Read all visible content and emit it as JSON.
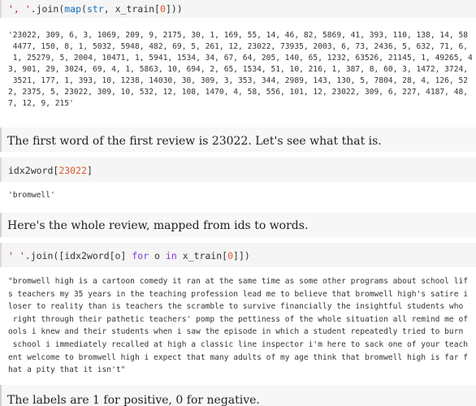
{
  "cells": {
    "code1": {
      "p1": "', '",
      "p2": ".join(",
      "p3": "map",
      "p4": "(",
      "p5": "str",
      "p6": ", x_train[",
      "p7": "0",
      "p8": "]))"
    },
    "out1_lines": [
      "'23022, 309, 6, 3, 1069, 209, 9, 2175, 30, 1, 169, 55, 14, 46, 82, 5869, 41, 393, 110, 138, 14, 58",
      " 4477, 150, 8, 1, 5032, 5948, 482, 69, 5, 261, 12, 23022, 73935, 2003, 6, 73, 2436, 5, 632, 71, 6,",
      " 1, 25279, 5, 2004, 10471, 1, 5941, 1534, 34, 67, 64, 205, 140, 65, 1232, 63526, 21145, 1, 49265, 4",
      "3, 901, 29, 3024, 69, 4, 1, 5863, 10, 694, 2, 65, 1534, 51, 10, 216, 1, 387, 8, 60, 3, 1472, 3724,",
      " 3521, 177, 1, 393, 10, 1238, 14030, 30, 309, 3, 353, 344, 2989, 143, 130, 5, 7804, 28, 4, 126, 52",
      "2, 2375, 5, 23022, 309, 10, 532, 12, 108, 1470, 4, 58, 556, 101, 12, 23022, 309, 6, 227, 4187, 48,",
      "7, 12, 9, 215'"
    ],
    "md1": "The first word of the first review is 23022. Let's see what that is.",
    "code2": {
      "p1": "idx2word[",
      "p2": "23022",
      "p3": "]"
    },
    "out2": "'bromwell'",
    "md2": "Here's the whole review, mapped from ids to words.",
    "code3": {
      "p1": "' '",
      "p2": ".join([idx2word[o] ",
      "p3": "for",
      "p4": " o ",
      "p5": "in",
      "p6": " x_train[",
      "p7": "0",
      "p8": "]])"
    },
    "out3_lines": [
      "\"bromwell high is a cartoon comedy it ran at the same time as some other programs about school lif",
      "s teachers my 35 years in the teaching profession lead me to believe that bromwell high's satire i",
      "loser to reality than is teachers the scramble to survive financially the insightful students who",
      " right through their pathetic teachers' pomp the pettiness of the whole situation all remind me of",
      "ools i knew and their students when i saw the episode in which a student repeatedly tried to burn",
      " school i immediately recalled at high a classic line inspector i'm here to sack one of your teach",
      "ent welcome to bromwell high i expect that many adults of my age think that bromwell high is far f",
      "hat a pity that it isn't\""
    ],
    "md3": "The labels are 1 for positive, 0 for negative."
  }
}
